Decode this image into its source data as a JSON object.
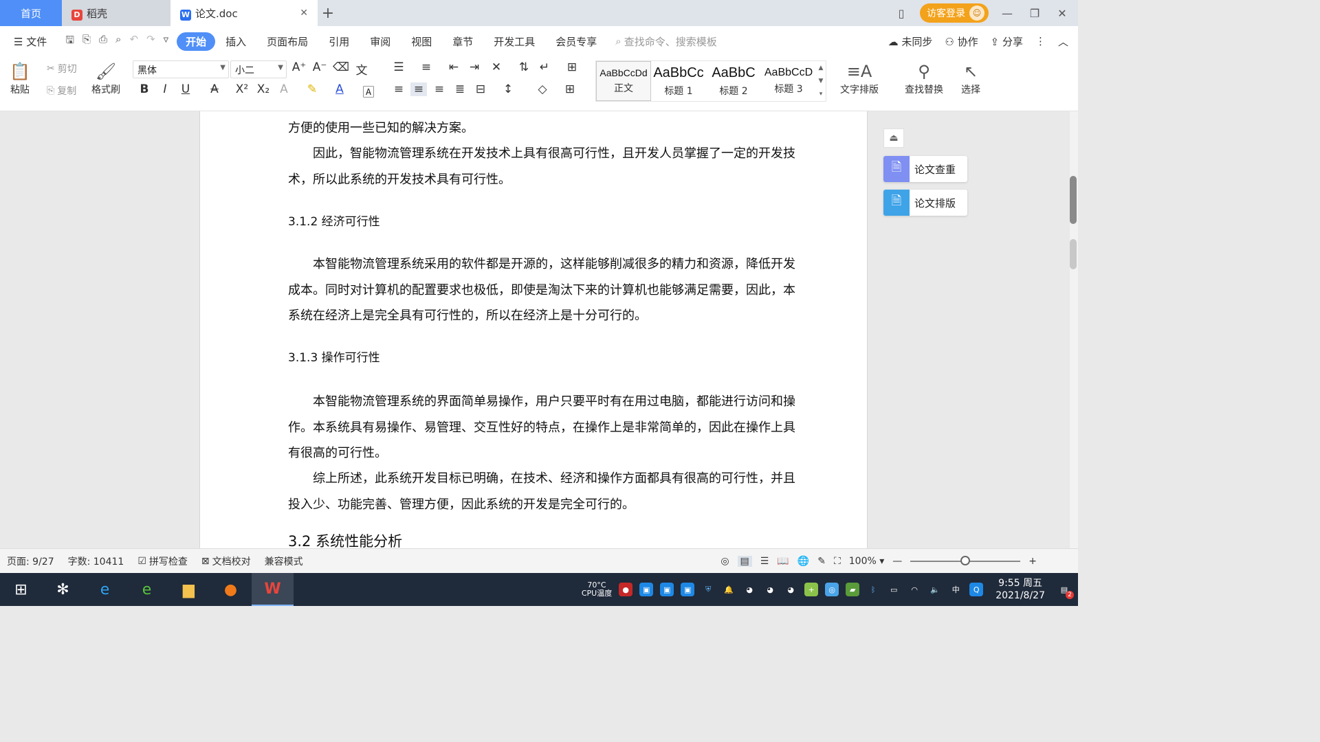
{
  "titlebar": {
    "tabs": [
      {
        "label": "首页"
      },
      {
        "label": "稻壳"
      },
      {
        "label": "论文.doc"
      }
    ],
    "visitor_login": "访客登录"
  },
  "menubar": {
    "file": "文件",
    "tabs": [
      "开始",
      "插入",
      "页面布局",
      "引用",
      "审阅",
      "视图",
      "章节",
      "开发工具",
      "会员专享"
    ],
    "search_placeholder": "查找命令、搜索模板",
    "right": [
      "未同步",
      "协作",
      "分享"
    ]
  },
  "ribbon": {
    "paste": "粘贴",
    "cut": "剪切",
    "copy": "复制",
    "format_painter": "格式刷",
    "font_name": "黑体",
    "font_size": "小二",
    "styles": [
      {
        "sample": "AaBbCcDd",
        "name": "正文"
      },
      {
        "sample": "AaBbCc",
        "name": "标题 1"
      },
      {
        "sample": "AaBbC",
        "name": "标题 2"
      },
      {
        "sample": "AaBbCcD",
        "name": "标题 3"
      }
    ],
    "text_layout": "文字排版",
    "find_replace": "查找替换",
    "select": "选择"
  },
  "document": {
    "p0": "方便的使用一些已知的解决方案。",
    "p1": "因此，智能物流管理系统在开发技术上具有很高可行性，且开发人员掌握了一定的开发技术，所以此系统的开发技术具有可行性。",
    "h_312": "3.1.2 经济可行性",
    "p2": "本智能物流管理系统采用的软件都是开源的，这样能够削减很多的精力和资源，降低开发成本。同时对计算机的配置要求也极低，即使是淘汰下来的计算机也能够满足需要，因此，本系统在经济上是完全具有可行性的，所以在经济上是十分可行的。",
    "h_313": "3.1.3 操作可行性",
    "p3": "本智能物流管理系统的界面简单易操作，用户只要平时有在用过电脑，都能进行访问和操作。本系统具有易操作、易管理、交互性好的特点，在操作上是非常简单的，因此在操作上具有很高的可行性。",
    "p4": "综上所述，此系统开发目标已明确，在技术、经济和操作方面都具有很高的可行性，并且投入少、功能完善、管理方便，因此系统的开发是完全可行的。",
    "h_32": "3.2 系统性能分析"
  },
  "side_panel": {
    "btn1": "论文查重",
    "btn2": "论文排版"
  },
  "statusbar": {
    "page": "页面: 9/27",
    "words": "字数: 10411",
    "spell": "拼写检查",
    "proof": "文档校对",
    "compat": "兼容模式",
    "zoom": "100%",
    "zoom_level": 0.5
  },
  "taskbar": {
    "cpu_temp": "70°C",
    "cpu_label": "CPU温度",
    "ime": "中",
    "time": "9:55 周五",
    "date": "2021/8/27",
    "notif_count": "2"
  },
  "colors": {
    "accent": "#4f8ff7",
    "visitor": "#f3a21b",
    "taskbar": "#1f2a3a"
  }
}
